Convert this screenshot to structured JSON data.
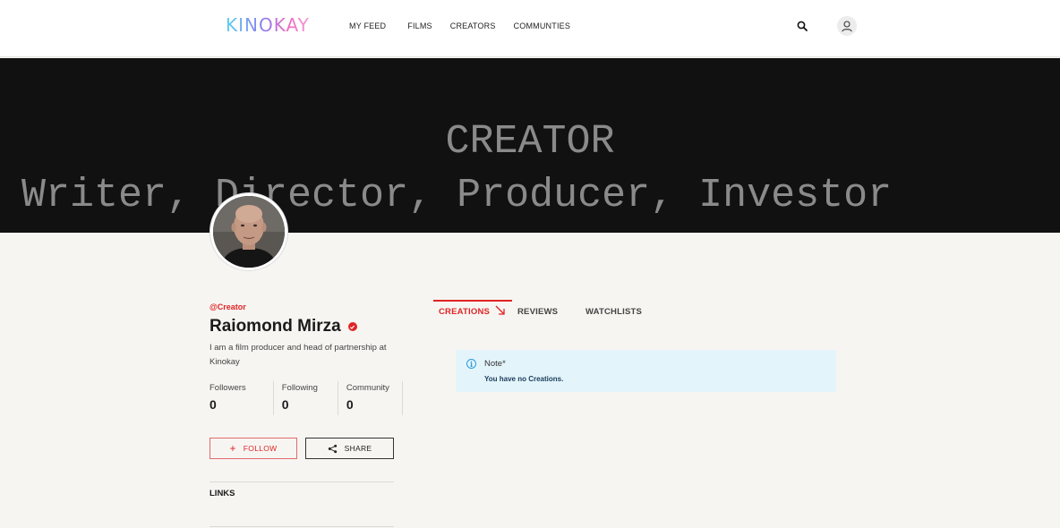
{
  "header": {
    "logo": "KINOKAY",
    "nav": [
      "MY FEED",
      "FILMS",
      "CREATORS",
      "COMMUNTIES"
    ]
  },
  "banner": {
    "title": "CREATOR",
    "roles": "Writer, Director, Producer, Investor"
  },
  "profile": {
    "handle": "@Creator",
    "name": "Raiomond Mirza",
    "bio": "I am a film producer and head of partnership at Kinokay",
    "stats": [
      {
        "label": "Followers",
        "value": "0"
      },
      {
        "label": "Following",
        "value": "0"
      },
      {
        "label": "Community",
        "value": "0"
      }
    ],
    "follow_label": "FOLLOW",
    "share_label": "SHARE",
    "links_label": "LINKS"
  },
  "tabs": [
    {
      "label": "CREATIONS",
      "active": true
    },
    {
      "label": "REVIEWS",
      "active": false
    },
    {
      "label": "WATCHLISTS",
      "active": false
    }
  ],
  "note": {
    "title": "Note*",
    "text": "You have no Creations."
  },
  "colors": {
    "accent": "#e02424",
    "note_bg": "#e3f5fb",
    "banner_bg": "#111111"
  },
  "icons": [
    "search-icon",
    "user-icon",
    "verified-icon",
    "plus-icon",
    "share-icon",
    "arrow-down-right-icon",
    "info-icon"
  ]
}
